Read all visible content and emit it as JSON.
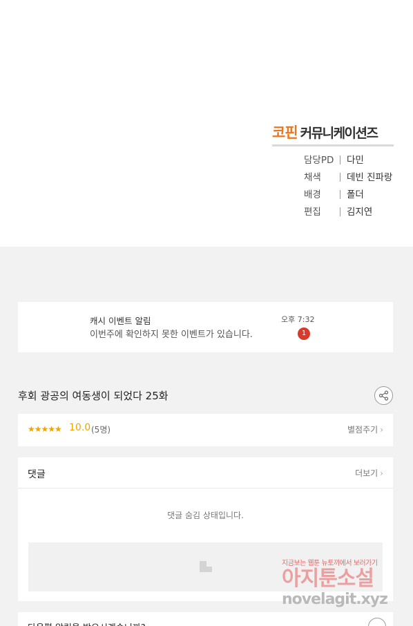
{
  "colors": {
    "accent": "#e8771f",
    "badge": "#d93a2b",
    "star": "#f0a500",
    "page_bg": "#f2f2f2"
  },
  "logo": {
    "accent_text": "코핀",
    "rest_text": "커뮤니케이션즈"
  },
  "credits": [
    {
      "role": "담당PD",
      "name": "다민"
    },
    {
      "role": "채색",
      "name": "데빈 진파랑"
    },
    {
      "role": "배경",
      "name": "폴더"
    },
    {
      "role": "편집",
      "name": "김지연"
    }
  ],
  "notice": {
    "title": "캐시 이벤트 알림",
    "time": "오후 7:32",
    "message": "이번주에 확인하지 못한 이벤트가 있습니다.",
    "badge_count": "1"
  },
  "episode": {
    "title": "후회 광공의 여동생이 되었다 25화",
    "share_icon": "share-icon"
  },
  "rating": {
    "stars": "★★★★★",
    "score": "10.0",
    "count": "(5명)",
    "action": "별점주기"
  },
  "comments": {
    "header": "댓글",
    "more": "더보기",
    "hidden_notice": "댓글 숨김 상태입니다."
  },
  "watermark": {
    "top": "지금보는 웹툰 뉴토끼에서 보러가기",
    "main": "아지툰소설",
    "url": "novelagit.xyz"
  },
  "bottom": {
    "text": "다음편 알림을 받으시겠습니까?"
  }
}
